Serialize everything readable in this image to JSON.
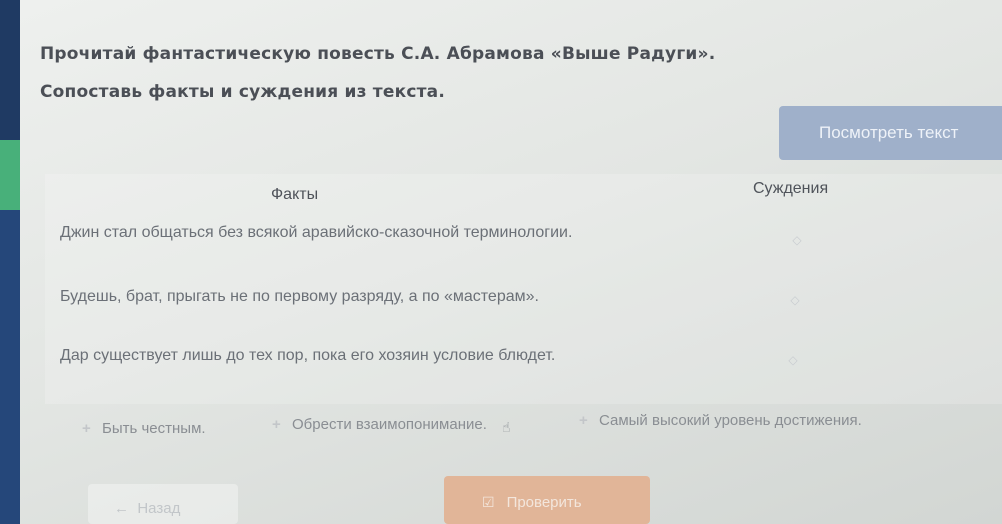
{
  "header": {
    "instruction_1": "Прочитай фантастическую повесть С.А. Абрамова «Выше Радуги».",
    "instruction_2": "Сопоставь факты и суждения из текста.",
    "view_text_button": "Посмотреть текст"
  },
  "table": {
    "facts_header": "Факты",
    "judgments_header": "Суждения",
    "facts": [
      "Джин стал общаться без всякой аравийско-сказочной терминологии.",
      "Будешь, брат, прыгать не по первому разряду, а по «мастерам».",
      "Дар существует лишь до тех пор, пока его хозяин условие блюдет."
    ]
  },
  "options": [
    "Быть честным.",
    "Обрести взаимопонимание.",
    "Самый высокий уровень достижения."
  ],
  "footer": {
    "back_button": "Назад",
    "check_button": "Проверить"
  },
  "icons": {
    "slot": "diamond-slot-icon",
    "plus": "plus-icon",
    "check": "check-icon",
    "back": "arrow-left-icon"
  }
}
